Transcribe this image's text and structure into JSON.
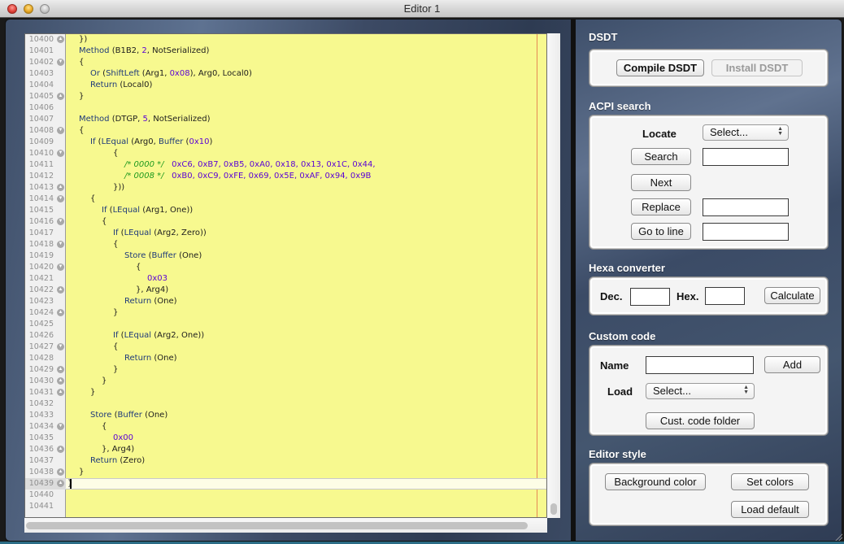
{
  "window": {
    "title": "Editor 1"
  },
  "editor": {
    "lines": [
      {
        "n": "10400",
        "fold": "up",
        "indent": 0,
        "tokens": [
          {
            "t": "})",
            "c": ""
          }
        ]
      },
      {
        "n": "10401",
        "fold": "",
        "indent": 0,
        "tokens": [
          {
            "t": "Method",
            "c": "kw"
          },
          {
            "t": " (B1B2, ",
            "c": ""
          },
          {
            "t": "2",
            "c": "num"
          },
          {
            "t": ", NotSerialized)",
            "c": ""
          }
        ]
      },
      {
        "n": "10402",
        "fold": "down",
        "indent": 0,
        "tokens": [
          {
            "t": "{",
            "c": ""
          }
        ]
      },
      {
        "n": "10403",
        "fold": "",
        "indent": 1,
        "tokens": [
          {
            "t": "Or",
            "c": "kw"
          },
          {
            "t": " (",
            "c": ""
          },
          {
            "t": "ShiftLeft",
            "c": "kw"
          },
          {
            "t": " (Arg1, ",
            "c": ""
          },
          {
            "t": "0x08",
            "c": "num"
          },
          {
            "t": "), Arg0, Local0)",
            "c": ""
          }
        ]
      },
      {
        "n": "10404",
        "fold": "",
        "indent": 1,
        "tokens": [
          {
            "t": "Return",
            "c": "kw"
          },
          {
            "t": " (Local0)",
            "c": ""
          }
        ]
      },
      {
        "n": "10405",
        "fold": "up",
        "indent": 0,
        "tokens": [
          {
            "t": "}",
            "c": ""
          }
        ]
      },
      {
        "n": "10406",
        "fold": "",
        "indent": 0,
        "tokens": []
      },
      {
        "n": "10407",
        "fold": "",
        "indent": 0,
        "tokens": [
          {
            "t": "Method",
            "c": "kw"
          },
          {
            "t": " (DTGP, ",
            "c": ""
          },
          {
            "t": "5",
            "c": "num"
          },
          {
            "t": ", NotSerialized)",
            "c": ""
          }
        ]
      },
      {
        "n": "10408",
        "fold": "down",
        "indent": 0,
        "tokens": [
          {
            "t": "{",
            "c": ""
          }
        ]
      },
      {
        "n": "10409",
        "fold": "",
        "indent": 1,
        "tokens": [
          {
            "t": "If",
            "c": "kw"
          },
          {
            "t": " (",
            "c": ""
          },
          {
            "t": "LEqual",
            "c": "kw"
          },
          {
            "t": " (Arg0, ",
            "c": ""
          },
          {
            "t": "Buffer",
            "c": "kw"
          },
          {
            "t": " (",
            "c": ""
          },
          {
            "t": "0x10",
            "c": "num"
          },
          {
            "t": ")",
            "c": ""
          }
        ]
      },
      {
        "n": "10410",
        "fold": "down",
        "indent": 3,
        "tokens": [
          {
            "t": "{",
            "c": ""
          }
        ]
      },
      {
        "n": "10411",
        "fold": "",
        "indent": 4,
        "tokens": [
          {
            "t": "/* 0000 */",
            "c": "cmt"
          },
          {
            "t": "   ",
            "c": ""
          },
          {
            "t": "0xC6, 0xB7, 0xB5, 0xA0, 0x18, 0x13, 0x1C, 0x44,",
            "c": "num"
          }
        ]
      },
      {
        "n": "10412",
        "fold": "",
        "indent": 4,
        "tokens": [
          {
            "t": "/* 0008 */",
            "c": "cmt"
          },
          {
            "t": "   ",
            "c": ""
          },
          {
            "t": "0xB0, 0xC9, 0xFE, 0x69, 0x5E, 0xAF, 0x94, 0x9B",
            "c": "num"
          }
        ]
      },
      {
        "n": "10413",
        "fold": "up",
        "indent": 3,
        "tokens": [
          {
            "t": "}))",
            "c": ""
          }
        ]
      },
      {
        "n": "10414",
        "fold": "down",
        "indent": 1,
        "tokens": [
          {
            "t": "{",
            "c": ""
          }
        ]
      },
      {
        "n": "10415",
        "fold": "",
        "indent": 2,
        "tokens": [
          {
            "t": "If",
            "c": "kw"
          },
          {
            "t": " (",
            "c": ""
          },
          {
            "t": "LEqual",
            "c": "kw"
          },
          {
            "t": " (Arg1, One))",
            "c": ""
          }
        ]
      },
      {
        "n": "10416",
        "fold": "down",
        "indent": 2,
        "tokens": [
          {
            "t": "{",
            "c": ""
          }
        ]
      },
      {
        "n": "10417",
        "fold": "",
        "indent": 3,
        "tokens": [
          {
            "t": "If",
            "c": "kw"
          },
          {
            "t": " (",
            "c": ""
          },
          {
            "t": "LEqual",
            "c": "kw"
          },
          {
            "t": " (Arg2, Zero))",
            "c": ""
          }
        ]
      },
      {
        "n": "10418",
        "fold": "down",
        "indent": 3,
        "tokens": [
          {
            "t": "{",
            "c": ""
          }
        ]
      },
      {
        "n": "10419",
        "fold": "",
        "indent": 4,
        "tokens": [
          {
            "t": "Store",
            "c": "kw"
          },
          {
            "t": " (",
            "c": ""
          },
          {
            "t": "Buffer",
            "c": "kw"
          },
          {
            "t": " (One)",
            "c": ""
          }
        ]
      },
      {
        "n": "10420",
        "fold": "down",
        "indent": 5,
        "tokens": [
          {
            "t": "{",
            "c": ""
          }
        ]
      },
      {
        "n": "10421",
        "fold": "",
        "indent": 6,
        "tokens": [
          {
            "t": "0x03",
            "c": "num"
          }
        ]
      },
      {
        "n": "10422",
        "fold": "up",
        "indent": 5,
        "tokens": [
          {
            "t": "}, Arg4)",
            "c": ""
          }
        ]
      },
      {
        "n": "10423",
        "fold": "",
        "indent": 4,
        "tokens": [
          {
            "t": "Return",
            "c": "kw"
          },
          {
            "t": " (One)",
            "c": ""
          }
        ]
      },
      {
        "n": "10424",
        "fold": "up",
        "indent": 3,
        "tokens": [
          {
            "t": "}",
            "c": ""
          }
        ]
      },
      {
        "n": "10425",
        "fold": "",
        "indent": 0,
        "tokens": []
      },
      {
        "n": "10426",
        "fold": "",
        "indent": 3,
        "tokens": [
          {
            "t": "If",
            "c": "kw"
          },
          {
            "t": " (",
            "c": ""
          },
          {
            "t": "LEqual",
            "c": "kw"
          },
          {
            "t": " (Arg2, One))",
            "c": ""
          }
        ]
      },
      {
        "n": "10427",
        "fold": "down",
        "indent": 3,
        "tokens": [
          {
            "t": "{",
            "c": ""
          }
        ]
      },
      {
        "n": "10428",
        "fold": "",
        "indent": 4,
        "tokens": [
          {
            "t": "Return",
            "c": "kw"
          },
          {
            "t": " (One)",
            "c": ""
          }
        ]
      },
      {
        "n": "10429",
        "fold": "up",
        "indent": 3,
        "tokens": [
          {
            "t": "}",
            "c": ""
          }
        ]
      },
      {
        "n": "10430",
        "fold": "up",
        "indent": 2,
        "tokens": [
          {
            "t": "}",
            "c": ""
          }
        ]
      },
      {
        "n": "10431",
        "fold": "up",
        "indent": 1,
        "tokens": [
          {
            "t": "}",
            "c": ""
          }
        ]
      },
      {
        "n": "10432",
        "fold": "",
        "indent": 0,
        "tokens": []
      },
      {
        "n": "10433",
        "fold": "",
        "indent": 1,
        "tokens": [
          {
            "t": "Store",
            "c": "kw"
          },
          {
            "t": " (",
            "c": ""
          },
          {
            "t": "Buffer",
            "c": "kw"
          },
          {
            "t": " (One)",
            "c": ""
          }
        ]
      },
      {
        "n": "10434",
        "fold": "down",
        "indent": 2,
        "tokens": [
          {
            "t": "{",
            "c": ""
          }
        ]
      },
      {
        "n": "10435",
        "fold": "",
        "indent": 3,
        "tokens": [
          {
            "t": "0x00",
            "c": "num"
          }
        ]
      },
      {
        "n": "10436",
        "fold": "up",
        "indent": 2,
        "tokens": [
          {
            "t": "}, Arg4)",
            "c": ""
          }
        ]
      },
      {
        "n": "10437",
        "fold": "",
        "indent": 1,
        "tokens": [
          {
            "t": "Return",
            "c": "kw"
          },
          {
            "t": " (Zero)",
            "c": ""
          }
        ]
      },
      {
        "n": "10438",
        "fold": "up",
        "indent": 0,
        "tokens": [
          {
            "t": "}",
            "c": ""
          }
        ]
      },
      {
        "n": "10439",
        "fold": "up",
        "indent": -1,
        "tokens": [
          {
            "t": "}",
            "c": ""
          }
        ],
        "current": true
      },
      {
        "n": "10440",
        "fold": "",
        "indent": 0,
        "tokens": []
      },
      {
        "n": "10441",
        "fold": "",
        "indent": 0,
        "tokens": []
      }
    ],
    "background_color": "#f7f98f"
  },
  "panel": {
    "dsdt": {
      "title": "DSDT",
      "compile_label": "Compile DSDT",
      "install_label": "Install DSDT"
    },
    "acpi_search": {
      "title": "ACPI search",
      "locate_label": "Locate",
      "locate_value": "Select...",
      "search_label": "Search",
      "search_value": "",
      "next_label": "Next",
      "replace_label": "Replace",
      "replace_value": "",
      "goto_label": "Go to line",
      "goto_value": ""
    },
    "hexa": {
      "title": "Hexa converter",
      "dec_label": "Dec.",
      "dec_value": "",
      "hex_label": "Hex.",
      "hex_value": "",
      "calculate_label": "Calculate"
    },
    "custom_code": {
      "title": "Custom code",
      "name_label": "Name",
      "name_value": "",
      "add_label": "Add",
      "load_label": "Load",
      "load_value": "Select...",
      "folder_label": "Cust. code folder"
    },
    "editor_style": {
      "title": "Editor style",
      "bg_color_label": "Background color",
      "set_colors_label": "Set colors",
      "load_default_label": "Load default"
    }
  }
}
